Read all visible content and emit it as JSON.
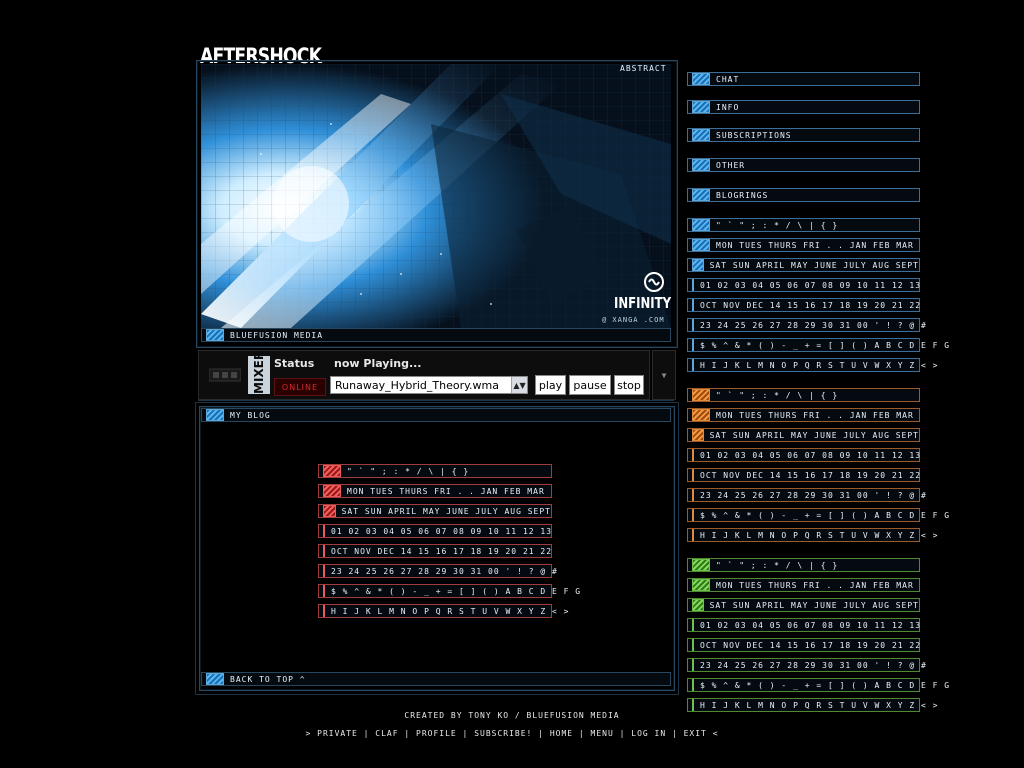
{
  "site": {
    "title": "AFTERSHOCK"
  },
  "hero": {
    "corner_label": "ABSTRACT",
    "caption": "BLUEFUSION MEDIA",
    "brand": "INFINITY",
    "brand_sub": "@ XANGA .COM"
  },
  "mixer": {
    "label": "MIXER",
    "status_label": "Status",
    "now_playing_label": "now Playing...",
    "online": "ONLINE",
    "track": "Runaway_Hybrid_Theory.wma",
    "play": "play",
    "pause": "pause",
    "stop": "stop"
  },
  "blog": {
    "header": "MY BLOG",
    "back_to_top": "BACK TO TOP ^"
  },
  "glyph_rows": [
    "\" ` \" ; : * / \\ | { }",
    "MON TUES THURS FRI . . JAN FEB MAR",
    "SAT SUN APRIL MAY JUNE JULY AUG SEPT",
    "01 02 03 04 05 06 07 08 09 10 11 12 13",
    "OCT NOV DEC 14 15 16 17 18 19 20 21 22",
    "23 24 25 26 27 28 29 30 31 00 ' ! ? @ #",
    "$ % ^ & * ( ) - _ + = [ ] ( ) A B C D E F G",
    "H I J K L M N O P Q R S T U V W X Y Z < >"
  ],
  "nav": [
    {
      "label": "CHAT"
    },
    {
      "label": "INFO"
    },
    {
      "label": "SUBSCRIPTIONS"
    },
    {
      "label": "OTHER"
    },
    {
      "label": "BLOGRINGS"
    }
  ],
  "footer": {
    "credit": "CREATED BY TONY KO / BLUEFUSION MEDIA",
    "links_prefix": ">",
    "links": [
      "PRIVATE",
      "CLAF",
      "PROFILE",
      "SUBSCRIBE!",
      "HOME",
      "MENU",
      "LOG IN",
      "EXIT"
    ],
    "links_suffix": "<"
  },
  "colors": {
    "accent_blue": "#3c8ed6",
    "accent_orange": "#e08a3a",
    "accent_green": "#6dc24c",
    "accent_red": "#ea5a5a",
    "online_red": "#d92b2b"
  }
}
